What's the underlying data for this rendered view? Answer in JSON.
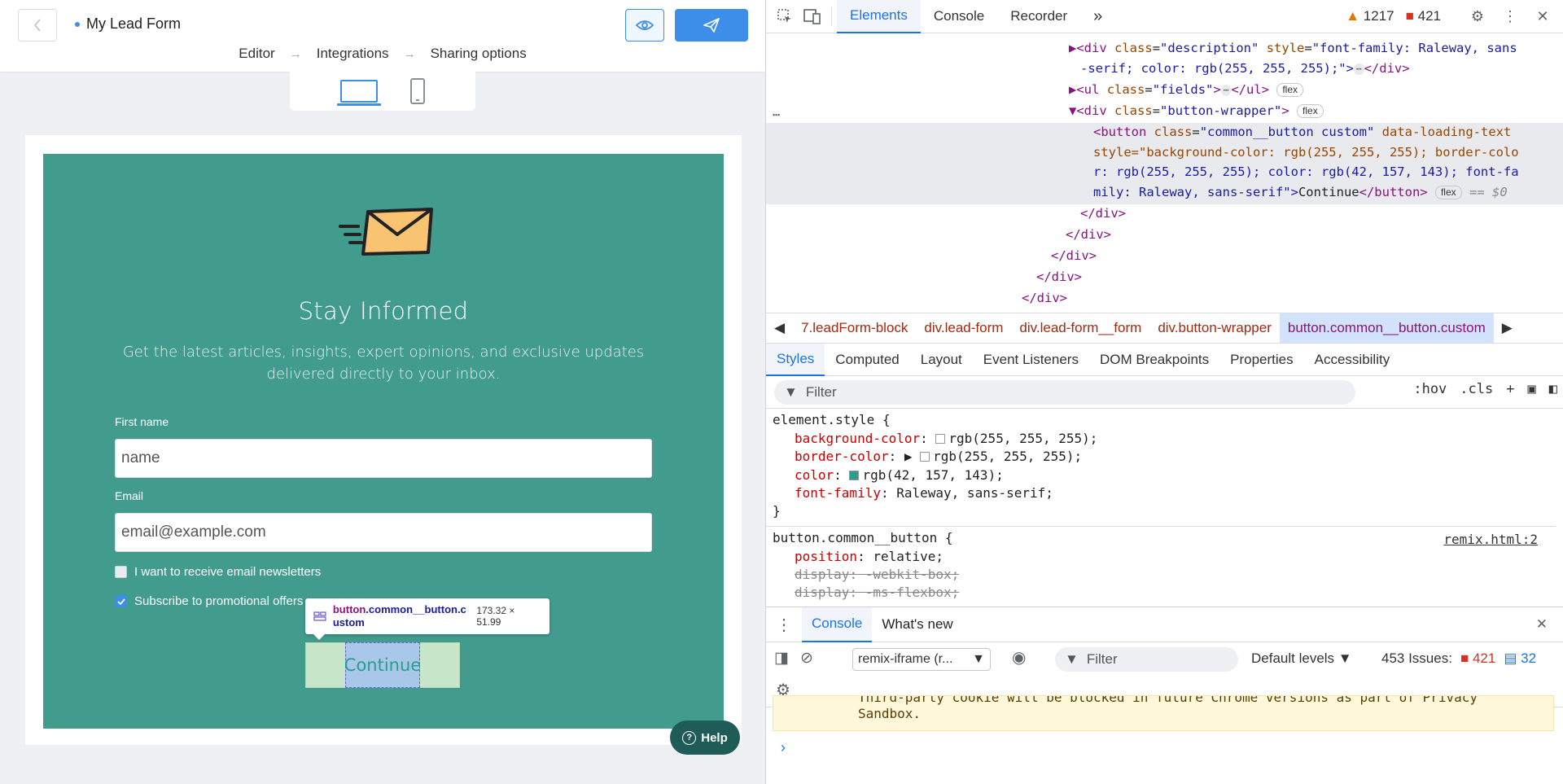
{
  "app": {
    "back_icon": "chevron-left-icon",
    "form_title": "My Lead Form",
    "steps": [
      "Editor",
      "Integrations",
      "Sharing options"
    ],
    "step_arrow": "→",
    "preview_icon": "eye-icon",
    "publish_icon": "paper-plane-icon"
  },
  "lead_form": {
    "background": "#429c8e",
    "title": "Stay Informed",
    "description": "Get the latest articles, insights, expert opinions, and exclusive updates delivered directly to your inbox.",
    "fields": [
      {
        "label": "First name",
        "value": "name"
      },
      {
        "label": "Email",
        "value": "email@example.com"
      }
    ],
    "checkboxes": [
      {
        "label": "I want to receive email newsletters",
        "checked": false
      },
      {
        "label": "Subscribe to promotional offers",
        "checked": true
      }
    ],
    "button_label": "Continue",
    "button_text_color": "#2a9d8f"
  },
  "inspector_tooltip": {
    "selector_tag": "button",
    "selector_class": ".common__button.custom",
    "dimensions": "173.32 × 51.99"
  },
  "help": {
    "label": "Help"
  },
  "devtools": {
    "tabs": [
      "Elements",
      "Console",
      "Recorder"
    ],
    "more": "»",
    "warnings": "1217",
    "errors": "421",
    "dom_lines": [
      {
        "tag": "<div",
        "attrs": [
          [
            "class",
            "\"description\""
          ],
          [
            "style",
            "\"font-family: Raleway, sans"
          ]
        ],
        "end": ""
      },
      {
        "cont": "-serif; color: rgb(255, 255, 255);\">",
        "after": "</div>"
      },
      {
        "tag": "<ul",
        "attrs": [
          [
            "class",
            "\"fields\""
          ]
        ],
        "end": ">",
        "after": "</ul>",
        "badge": "flex"
      },
      {
        "tag": "<div",
        "attrs": [
          [
            "class",
            "\"button-wrapper\""
          ]
        ],
        "end": ">",
        "badge": "flex"
      },
      {
        "tag": "<button",
        "attrs": [
          [
            "class",
            "\"common__button custom\""
          ],
          [
            "data-loading-text",
            ""
          ]
        ],
        "end": ""
      },
      {
        "cont2": "style=\"background-color: rgb(255, 255, 255); border-colo"
      },
      {
        "cont2": "r: rgb(255, 255, 255); color: rgb(42, 157, 143); font-fa"
      },
      {
        "cont3": "mily: Raleway, sans-serif\">",
        "text": "Continue",
        "close": "</button>",
        "badge": "flex",
        "eq": "== $0"
      },
      {
        "close": "</div>"
      },
      {
        "close": "</div>"
      },
      {
        "close": "</div>"
      },
      {
        "close": "</div>"
      },
      {
        "close": "</div>"
      }
    ],
    "breadcrumbs": [
      "7.leadForm-block",
      "div.lead-form",
      "div.lead-form__form",
      "div.button-wrapper",
      "button.common__button.custom"
    ],
    "sub_tabs": [
      "Styles",
      "Computed",
      "Layout",
      "Event Listeners",
      "DOM Breakpoints",
      "Properties",
      "Accessibility"
    ],
    "styles_filter_placeholder": "Filter",
    "styles_tools": [
      ":hov",
      ".cls"
    ],
    "element_style": {
      "selector": "element.style {",
      "props": [
        {
          "name": "background-color",
          "value": "rgb(255, 255, 255);",
          "swatch": "#ffffff"
        },
        {
          "name": "border-color",
          "value": "rgb(255, 255, 255);",
          "swatch": "#ffffff",
          "expand": true
        },
        {
          "name": "color",
          "value": "rgb(42, 157, 143);",
          "swatch": "#2a9d8f"
        },
        {
          "name": "font-family",
          "value": "Raleway, sans-serif;"
        }
      ],
      "close": "}"
    },
    "rule2": {
      "selector": "button.common__button {",
      "source": "remix.html:2",
      "props": [
        {
          "name": "position",
          "value": "relative;",
          "struck": false
        },
        {
          "name": "display",
          "value": "-webkit-box;",
          "struck": true
        },
        {
          "name": "display",
          "value": "-ms-flexbox;",
          "struck": true
        }
      ]
    },
    "drawer_tabs": [
      "Console",
      "What's new"
    ],
    "context": "remix-iframe (r...",
    "console_filter_placeholder": "Filter",
    "levels": "Default levels",
    "issues_label": "453 Issues:",
    "issues_errors": "421",
    "issues_info": "32",
    "console_message_line1": "Third-party cookie will be blocked in future Chrome versions as part of Privacy",
    "console_message_line2": "Sandbox.",
    "prompt": "›"
  }
}
